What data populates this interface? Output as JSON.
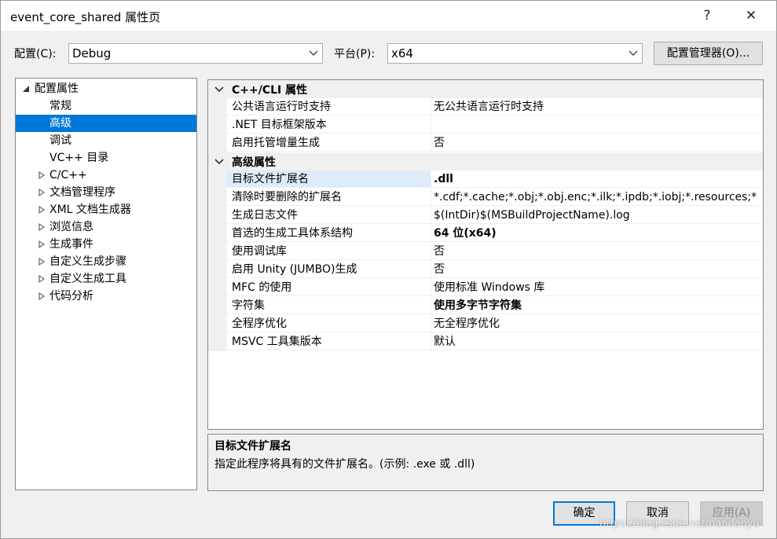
{
  "window": {
    "title": "event_core_shared 属性页",
    "help_label": "?",
    "close_label": "✕"
  },
  "config": {
    "label": "配置(C):",
    "value": "Debug"
  },
  "platform": {
    "label": "平台(P):",
    "value": "x64"
  },
  "config_manager_label": "配置管理器(O)...",
  "tree": {
    "root": "配置属性",
    "items": [
      {
        "label": "常规",
        "expandable": false
      },
      {
        "label": "高级",
        "expandable": false,
        "selected": true
      },
      {
        "label": "调试",
        "expandable": false
      },
      {
        "label": "VC++ 目录",
        "expandable": false
      },
      {
        "label": "C/C++",
        "expandable": true
      },
      {
        "label": "文档管理程序",
        "expandable": true
      },
      {
        "label": "XML 文档生成器",
        "expandable": true
      },
      {
        "label": "浏览信息",
        "expandable": true
      },
      {
        "label": "生成事件",
        "expandable": true
      },
      {
        "label": "自定义生成步骤",
        "expandable": true
      },
      {
        "label": "自定义生成工具",
        "expandable": true
      },
      {
        "label": "代码分析",
        "expandable": true
      }
    ]
  },
  "grid": {
    "categories": [
      {
        "name": "C++/CLI 属性",
        "rows": [
          {
            "name": "公共语言运行时支持",
            "value": "无公共语言运行时支持"
          },
          {
            "name": ".NET 目标框架版本",
            "value": ""
          },
          {
            "name": "启用托管增量生成",
            "value": "否"
          }
        ]
      },
      {
        "name": "高级属性",
        "rows": [
          {
            "name": "目标文件扩展名",
            "value": ".dll",
            "bold": true,
            "selected": true
          },
          {
            "name": "清除时要删除的扩展名",
            "value": "*.cdf;*.cache;*.obj;*.obj.enc;*.ilk;*.ipdb;*.iobj;*.resources;*"
          },
          {
            "name": "生成日志文件",
            "value": "$(IntDir)$(MSBuildProjectName).log"
          },
          {
            "name": "首选的生成工具体系结构",
            "value": "64 位(x64)",
            "bold": true
          },
          {
            "name": "使用调试库",
            "value": "否"
          },
          {
            "name": "启用 Unity (JUMBO)生成",
            "value": "否"
          },
          {
            "name": "MFC 的使用",
            "value": "使用标准 Windows 库"
          },
          {
            "name": "字符集",
            "value": "使用多字节字符集",
            "bold": true
          },
          {
            "name": "全程序优化",
            "value": "无全程序优化"
          },
          {
            "name": "MSVC 工具集版本",
            "value": "默认"
          }
        ]
      }
    ]
  },
  "description": {
    "title": "目标文件扩展名",
    "text": "指定此程序将具有的文件扩展名。(示例: .exe 或 .dll)"
  },
  "buttons": {
    "ok": "确定",
    "cancel": "取消",
    "apply": "应用(A)"
  },
  "watermark": "https://blog.csdn.net/bandaoyu",
  "colors": {
    "selection": "#0078d7",
    "selected_row": "#ddecfb",
    "background": "#f0f0f0"
  }
}
